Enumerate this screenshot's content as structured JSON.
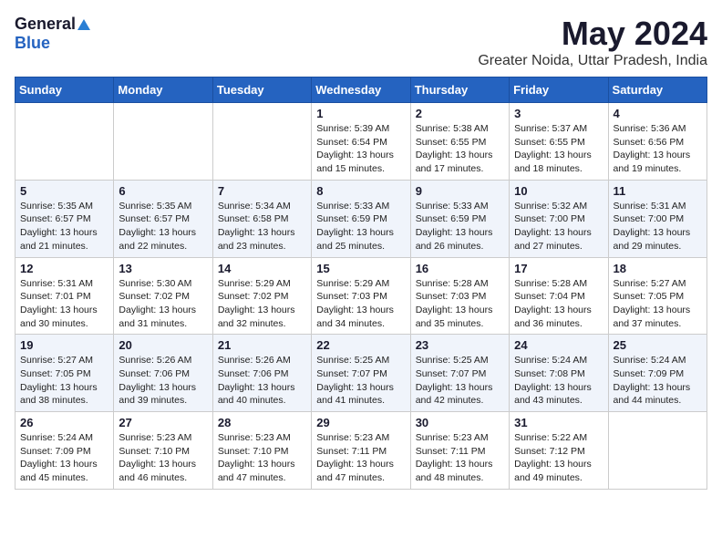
{
  "logo": {
    "general": "General",
    "blue": "Blue"
  },
  "header": {
    "month": "May 2024",
    "location": "Greater Noida, Uttar Pradesh, India"
  },
  "weekdays": [
    "Sunday",
    "Monday",
    "Tuesday",
    "Wednesday",
    "Thursday",
    "Friday",
    "Saturday"
  ],
  "weeks": [
    [
      {
        "day": "",
        "info": ""
      },
      {
        "day": "",
        "info": ""
      },
      {
        "day": "",
        "info": ""
      },
      {
        "day": "1",
        "info": "Sunrise: 5:39 AM\nSunset: 6:54 PM\nDaylight: 13 hours\nand 15 minutes."
      },
      {
        "day": "2",
        "info": "Sunrise: 5:38 AM\nSunset: 6:55 PM\nDaylight: 13 hours\nand 17 minutes."
      },
      {
        "day": "3",
        "info": "Sunrise: 5:37 AM\nSunset: 6:55 PM\nDaylight: 13 hours\nand 18 minutes."
      },
      {
        "day": "4",
        "info": "Sunrise: 5:36 AM\nSunset: 6:56 PM\nDaylight: 13 hours\nand 19 minutes."
      }
    ],
    [
      {
        "day": "5",
        "info": "Sunrise: 5:35 AM\nSunset: 6:57 PM\nDaylight: 13 hours\nand 21 minutes."
      },
      {
        "day": "6",
        "info": "Sunrise: 5:35 AM\nSunset: 6:57 PM\nDaylight: 13 hours\nand 22 minutes."
      },
      {
        "day": "7",
        "info": "Sunrise: 5:34 AM\nSunset: 6:58 PM\nDaylight: 13 hours\nand 23 minutes."
      },
      {
        "day": "8",
        "info": "Sunrise: 5:33 AM\nSunset: 6:59 PM\nDaylight: 13 hours\nand 25 minutes."
      },
      {
        "day": "9",
        "info": "Sunrise: 5:33 AM\nSunset: 6:59 PM\nDaylight: 13 hours\nand 26 minutes."
      },
      {
        "day": "10",
        "info": "Sunrise: 5:32 AM\nSunset: 7:00 PM\nDaylight: 13 hours\nand 27 minutes."
      },
      {
        "day": "11",
        "info": "Sunrise: 5:31 AM\nSunset: 7:00 PM\nDaylight: 13 hours\nand 29 minutes."
      }
    ],
    [
      {
        "day": "12",
        "info": "Sunrise: 5:31 AM\nSunset: 7:01 PM\nDaylight: 13 hours\nand 30 minutes."
      },
      {
        "day": "13",
        "info": "Sunrise: 5:30 AM\nSunset: 7:02 PM\nDaylight: 13 hours\nand 31 minutes."
      },
      {
        "day": "14",
        "info": "Sunrise: 5:29 AM\nSunset: 7:02 PM\nDaylight: 13 hours\nand 32 minutes."
      },
      {
        "day": "15",
        "info": "Sunrise: 5:29 AM\nSunset: 7:03 PM\nDaylight: 13 hours\nand 34 minutes."
      },
      {
        "day": "16",
        "info": "Sunrise: 5:28 AM\nSunset: 7:03 PM\nDaylight: 13 hours\nand 35 minutes."
      },
      {
        "day": "17",
        "info": "Sunrise: 5:28 AM\nSunset: 7:04 PM\nDaylight: 13 hours\nand 36 minutes."
      },
      {
        "day": "18",
        "info": "Sunrise: 5:27 AM\nSunset: 7:05 PM\nDaylight: 13 hours\nand 37 minutes."
      }
    ],
    [
      {
        "day": "19",
        "info": "Sunrise: 5:27 AM\nSunset: 7:05 PM\nDaylight: 13 hours\nand 38 minutes."
      },
      {
        "day": "20",
        "info": "Sunrise: 5:26 AM\nSunset: 7:06 PM\nDaylight: 13 hours\nand 39 minutes."
      },
      {
        "day": "21",
        "info": "Sunrise: 5:26 AM\nSunset: 7:06 PM\nDaylight: 13 hours\nand 40 minutes."
      },
      {
        "day": "22",
        "info": "Sunrise: 5:25 AM\nSunset: 7:07 PM\nDaylight: 13 hours\nand 41 minutes."
      },
      {
        "day": "23",
        "info": "Sunrise: 5:25 AM\nSunset: 7:07 PM\nDaylight: 13 hours\nand 42 minutes."
      },
      {
        "day": "24",
        "info": "Sunrise: 5:24 AM\nSunset: 7:08 PM\nDaylight: 13 hours\nand 43 minutes."
      },
      {
        "day": "25",
        "info": "Sunrise: 5:24 AM\nSunset: 7:09 PM\nDaylight: 13 hours\nand 44 minutes."
      }
    ],
    [
      {
        "day": "26",
        "info": "Sunrise: 5:24 AM\nSunset: 7:09 PM\nDaylight: 13 hours\nand 45 minutes."
      },
      {
        "day": "27",
        "info": "Sunrise: 5:23 AM\nSunset: 7:10 PM\nDaylight: 13 hours\nand 46 minutes."
      },
      {
        "day": "28",
        "info": "Sunrise: 5:23 AM\nSunset: 7:10 PM\nDaylight: 13 hours\nand 47 minutes."
      },
      {
        "day": "29",
        "info": "Sunrise: 5:23 AM\nSunset: 7:11 PM\nDaylight: 13 hours\nand 47 minutes."
      },
      {
        "day": "30",
        "info": "Sunrise: 5:23 AM\nSunset: 7:11 PM\nDaylight: 13 hours\nand 48 minutes."
      },
      {
        "day": "31",
        "info": "Sunrise: 5:22 AM\nSunset: 7:12 PM\nDaylight: 13 hours\nand 49 minutes."
      },
      {
        "day": "",
        "info": ""
      }
    ]
  ]
}
